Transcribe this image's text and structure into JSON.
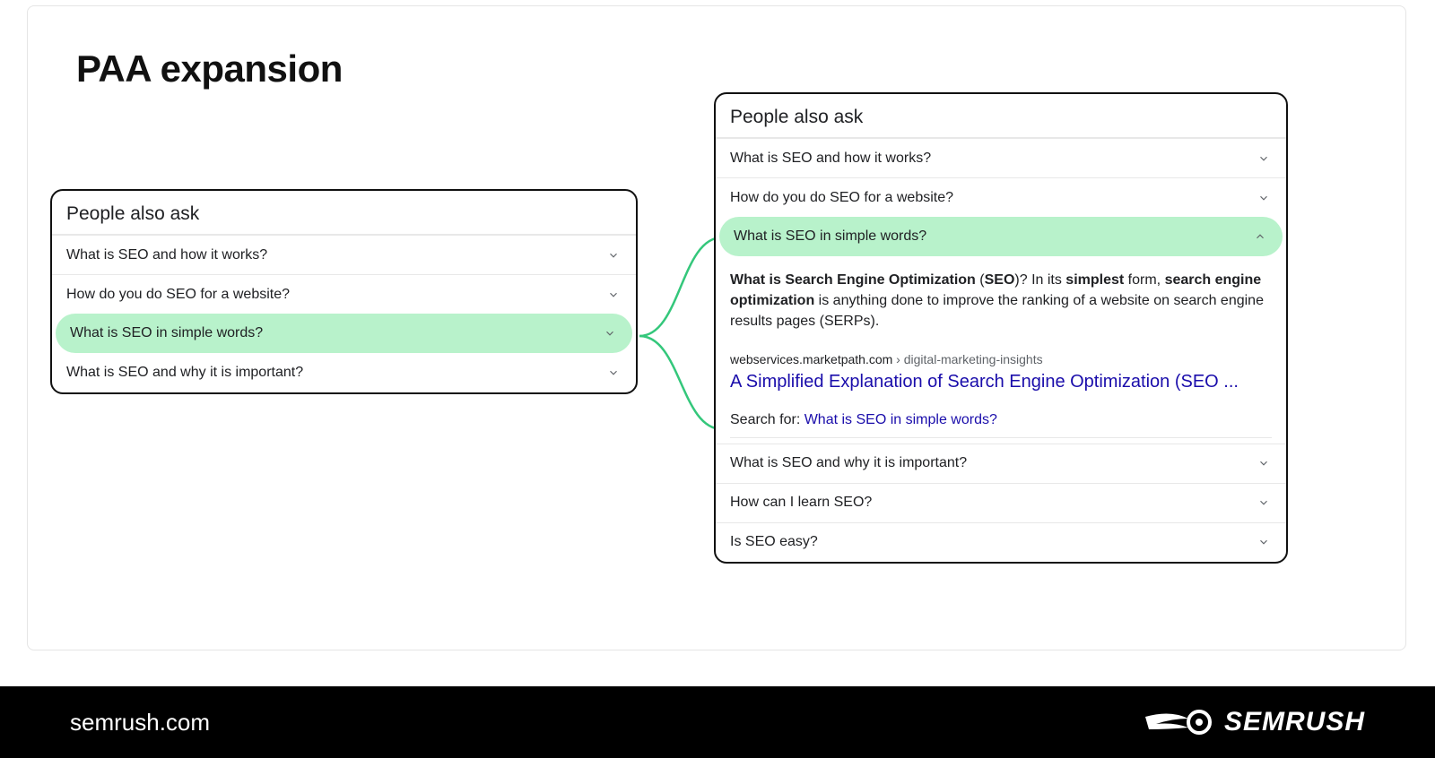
{
  "title": "PAA expansion",
  "footer": {
    "site": "semrush.com",
    "brand": "SEMRUSH"
  },
  "left": {
    "heading": "People also ask",
    "rows": [
      {
        "q": "What is SEO and how it works?",
        "hl": false
      },
      {
        "q": "How do you do SEO for a website?",
        "hl": false
      },
      {
        "q": "What is SEO in simple words?",
        "hl": true
      },
      {
        "q": "What is SEO and why it is important?",
        "hl": false
      }
    ]
  },
  "right": {
    "heading": "People also ask",
    "rows_before": [
      {
        "q": "What is SEO and how it works?"
      },
      {
        "q": "How do you do SEO for a website?"
      }
    ],
    "expanded": {
      "q": "What is SEO in simple words?",
      "snippet_html": "<b>What is Search Engine Optimization</b> (<b>SEO</b>)? In its <b>simplest</b> form, <b>search engine optimization</b> is anything done to improve the ranking of a website on search engine results pages (SERPs).",
      "crumb_host": "webservices.marketpath.com",
      "crumb_path": " › digital-marketing-insights",
      "result_title": "A Simplified Explanation of Search Engine Optimization (SEO ...",
      "search_for_label": "Search for: ",
      "search_for_link": "What is SEO in simple words?"
    },
    "rows_after": [
      {
        "q": "What is SEO and why it is important?"
      },
      {
        "q": "How can I learn SEO?"
      },
      {
        "q": "Is SEO easy?"
      }
    ]
  }
}
